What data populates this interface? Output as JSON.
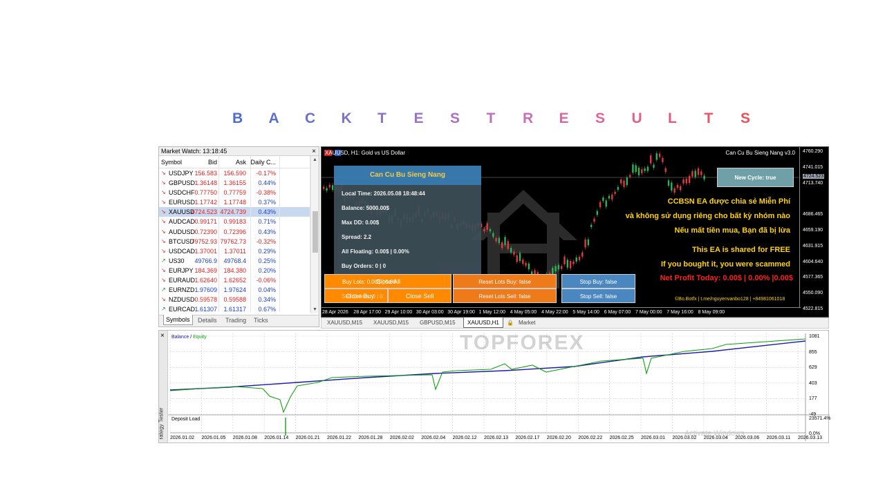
{
  "heading": {
    "letters": [
      {
        "ch": "B",
        "color": "#4d6bd2"
      },
      {
        "ch": "A",
        "color": "#5a6fd0"
      },
      {
        "ch": "C",
        "color": "#6a70cf"
      },
      {
        "ch": "K",
        "color": "#7b72cc"
      },
      {
        "ch": "T",
        "color": "#8a73c9"
      },
      {
        "ch": "E",
        "color": "#9b73c6"
      },
      {
        "ch": "S",
        "color": "#ab72c2"
      },
      {
        "ch": "T",
        "color": "#bc71bc"
      },
      {
        "ch": "R",
        "color": "#c96fb4"
      },
      {
        "ch": "E",
        "color": "#d46ba8"
      },
      {
        "ch": "S",
        "color": "#dc6699"
      },
      {
        "ch": "U",
        "color": "#e1608a"
      },
      {
        "ch": "L",
        "color": "#e45a7a"
      },
      {
        "ch": "T",
        "color": "#e7556a"
      },
      {
        "ch": "S",
        "color": "#e9505b"
      }
    ]
  },
  "market_watch": {
    "title": "Market Watch: 13:18:45",
    "close": "×",
    "columns": {
      "symbol": "Symbol",
      "bid": "Bid",
      "ask": "Ask",
      "change": "Daily C..."
    },
    "rows": [
      {
        "dir": "down",
        "symbol": "USDJPY",
        "bid": "156.583",
        "ask": "156.590",
        "change": "-0.17%"
      },
      {
        "dir": "down",
        "symbol": "GBPUSD",
        "bid": "1.36148",
        "ask": "1.36155",
        "change": "0.44%"
      },
      {
        "dir": "down",
        "symbol": "USDCHF",
        "bid": "0.77750",
        "ask": "0.77759",
        "change": "-0.38%"
      },
      {
        "dir": "down",
        "symbol": "EURUSD",
        "bid": "1.17742",
        "ask": "1.17748",
        "change": "0.37%"
      },
      {
        "dir": "down",
        "symbol": "XAUUSD",
        "bid": "4724.523",
        "ask": "4724.739",
        "change": "0.43%",
        "selected": true
      },
      {
        "dir": "down",
        "symbol": "AUDCAD",
        "bid": "0.99171",
        "ask": "0.99183",
        "change": "0.71%"
      },
      {
        "dir": "down",
        "symbol": "AUDUSD",
        "bid": "0.72390",
        "ask": "0.72396",
        "change": "0.43%"
      },
      {
        "dir": "down",
        "symbol": "BTCUSD",
        "bid": "79752.93",
        "ask": "79762.73",
        "change": "-0.32%"
      },
      {
        "dir": "down",
        "symbol": "USDCAD",
        "bid": "1.37001",
        "ask": "1.37011",
        "change": "0.29%"
      },
      {
        "dir": "up",
        "symbol": "US30",
        "bid": "49766.9",
        "ask": "49768.4",
        "change": "0.25%"
      },
      {
        "dir": "down",
        "symbol": "EURJPY",
        "bid": "184.369",
        "ask": "184.380",
        "change": "0.20%"
      },
      {
        "dir": "down",
        "symbol": "EURAUD",
        "bid": "1.62640",
        "ask": "1.62652",
        "change": "-0.06%"
      },
      {
        "dir": "up",
        "symbol": "EURNZD",
        "bid": "1.97609",
        "ask": "1.97624",
        "change": "0.04%"
      },
      {
        "dir": "down",
        "symbol": "NZDUSD",
        "bid": "0.59578",
        "ask": "0.59588",
        "change": "0.34%"
      },
      {
        "dir": "up",
        "symbol": "EURCAD",
        "bid": "1.61307",
        "ask": "1.61317",
        "change": "0.67%"
      }
    ],
    "tabs": [
      "Symbols",
      "Details",
      "Trading",
      "Ticks"
    ],
    "colors": {
      "up": "#1a8a1a",
      "down": "#e02020",
      "bid_down": "#e02020",
      "bid_up": "#1a3fd0",
      "neg": "#e02020",
      "pos": "#1a3fd0"
    }
  },
  "chart": {
    "title": "XAUUSD, H1:  Gold vs US Dollar",
    "brand": "Can Cu Bu Sieng Nang v3.0",
    "y_ticks": [
      "4760.290",
      "4741.015",
      "4724.523",
      "4713.740",
      "4686.465",
      "4659.190",
      "4631.915",
      "4604.640",
      "4577.365",
      "4550.090",
      "4522.815"
    ],
    "x_ticks": [
      "28 Apr 2026",
      "28 Apr 17:00",
      "29 Apr 10:00",
      "30 Apr 03:00",
      "30 Apr 19:00",
      "1 May 12:00",
      "4 May 05:00",
      "4 May 22:00",
      "5 May 14:00",
      "6 May 07:00",
      "7 May 00:00",
      "7 May 16:00",
      "8 May 09:00"
    ],
    "panel": {
      "title": "Can Cu Bu Sieng Nang",
      "local_time": "Local Time: 2026.05.08 18:48:44",
      "balance": "Balance: 5000.00$",
      "max_dd": "Max DD: 0.00$",
      "spread": "Spread: 2.2",
      "floating": "All Floating: 0.00$ | 0.00%",
      "buy_orders": "Buy Orders: 0 | 0",
      "sell_orders": "Sell Orders: 0 | 0"
    },
    "buttons": {
      "buy_lots": "Buy Lots: 0.00$ | 0.00",
      "close_all": "Close All",
      "close_buy": "Close Buy",
      "close_sell": "Close Sell",
      "reset_buy": "Reset Lots Buy: false",
      "reset_sell": "Reset Lots Sell: false",
      "stop_buy": "Stop Buy: false",
      "stop_sell": "Stop Sell: false",
      "new_cycle": "New Cycle: true"
    },
    "messages": {
      "vn1": "CCBSN EA được chia sẻ Miễn Phí",
      "vn2": "và không sử dụng riêng cho bất kỳ nhóm nào",
      "vn3": "Nếu mất tiền mua, Bạn đã bị lừa",
      "en1": "This EA is shared for FREE",
      "en2": "If you bought it, you were scammed",
      "profit": "Net Profit Today: 0.00$ | 0.00% |0.00$"
    },
    "credit": "©Bo.Botfx | t.me/nguyenvanbo128 | +84981061018"
  },
  "chart_tabs": [
    "XAUUSD,M15",
    "XAUUSD,M15",
    "GBPUSD,M15",
    "XAUUSD,H1",
    "Market"
  ],
  "tester": {
    "legend_balance": "Balance",
    "legend_sep": " / ",
    "legend_equity": "Equity",
    "deposit_load": "Deposit Load",
    "side_label": "rategy Tester",
    "y_ticks": [
      "1081",
      "855",
      "629",
      "403",
      "177",
      "-49"
    ],
    "load_ticks": [
      "23571.4%",
      "0.0%"
    ],
    "x_ticks": [
      "2026.01.02",
      "2026.01.05",
      "2026.01.08",
      "2026.01.14",
      "2026.01.21",
      "2026.01.22",
      "2026.01.28",
      "2026.02.02",
      "2026.02.04",
      "2026.02.12",
      "2026.02.13",
      "2026.02.17",
      "2026.02.20",
      "2026.02.22",
      "2026.02.25",
      "2026.03.01",
      "2026.03.02",
      "2026.03.04",
      "2026.03.06",
      "2026.03.11",
      "2026.03.13"
    ],
    "colors": {
      "balance": "#1a1ab0",
      "equity": "#12a012"
    }
  },
  "watermark": "TOPFOREX",
  "activate": "Activate Windows"
}
